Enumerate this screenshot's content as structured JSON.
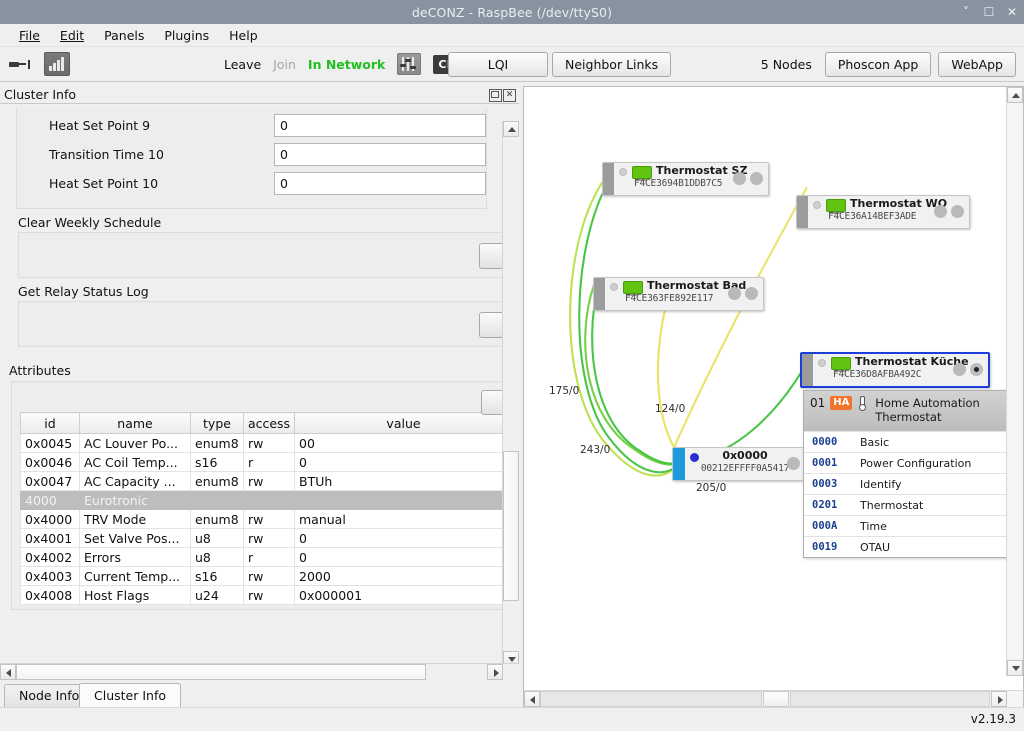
{
  "window": {
    "title": "deCONZ - RaspBee (/dev/ttyS0)",
    "minimize_icon": "chevron-down-icon",
    "maximize_icon": "square-icon",
    "close_icon": "close-icon"
  },
  "menubar": [
    {
      "label": "File"
    },
    {
      "label": "Edit"
    },
    {
      "label": "Panels"
    },
    {
      "label": "Plugins"
    },
    {
      "label": "Help"
    }
  ],
  "toolbar": {
    "connect_icon": "plug-icon",
    "stats_icon": "bar-chart-icon",
    "leave_label": "Leave",
    "join_label": "Join",
    "network_status": "In Network",
    "settings_icon": "sliders-icon",
    "cre_badge": "CRE",
    "lqi_label": "LQI",
    "neighbor_links_label": "Neighbor Links",
    "nodes_label": "5 Nodes",
    "phoscon_label": "Phoscon App",
    "webapp_label": "WebApp"
  },
  "dock": {
    "title": "Cluster Info",
    "float_icon": "undock-icon",
    "close_icon": "close-icon",
    "fields": [
      {
        "label": "Heat Set Point 9",
        "value": "0"
      },
      {
        "label": "Transition Time 10",
        "value": "0"
      },
      {
        "label": "Heat Set Point 10",
        "value": "0"
      }
    ],
    "commands": [
      {
        "label": "Clear Weekly Schedule"
      },
      {
        "label": "Get Relay Status Log"
      }
    ],
    "attributes_label": "Attributes",
    "table": {
      "headers": [
        "id",
        "name",
        "type",
        "access",
        "value"
      ],
      "rows": [
        {
          "group": false,
          "id": "0x0045",
          "name": "AC Louver Po...",
          "type": "enum8",
          "access": "rw",
          "value": "00"
        },
        {
          "group": false,
          "id": "0x0046",
          "name": "AC Coil Temp...",
          "type": "s16",
          "access": "r",
          "value": "0"
        },
        {
          "group": false,
          "id": "0x0047",
          "name": "AC Capacity ...",
          "type": "enum8",
          "access": "rw",
          "value": "BTUh"
        },
        {
          "group": true,
          "id": "4000",
          "name": "Eurotronic",
          "type": "",
          "access": "",
          "value": ""
        },
        {
          "group": false,
          "id": "0x4000",
          "name": "TRV Mode",
          "type": "enum8",
          "access": "rw",
          "value": "manual"
        },
        {
          "group": false,
          "id": "0x4001",
          "name": "Set Valve Pos...",
          "type": "u8",
          "access": "rw",
          "value": "0"
        },
        {
          "group": false,
          "id": "0x4002",
          "name": "Errors",
          "type": "u8",
          "access": "r",
          "value": "0"
        },
        {
          "group": false,
          "id": "0x4003",
          "name": "Current Temp...",
          "type": "s16",
          "access": "rw",
          "value": "2000"
        },
        {
          "group": false,
          "id": "0x4008",
          "name": "Host Flags",
          "type": "u24",
          "access": "rw",
          "value": "0x000001"
        }
      ]
    }
  },
  "tabs": [
    {
      "label": "Node Info",
      "active": false
    },
    {
      "label": "Cluster Info",
      "active": true
    }
  ],
  "graph": {
    "nodes": [
      {
        "name": "Thermostat SZ",
        "mac": "F4CE3694B1DDB7C5",
        "selected": false,
        "coordinator": false
      },
      {
        "name": "Thermostat WO",
        "mac": "F4CE36A14BEF3ADE",
        "selected": false,
        "coordinator": false
      },
      {
        "name": "Thermostat Bad",
        "mac": "F4CE363FE892E117",
        "selected": false,
        "coordinator": false
      },
      {
        "name": "Thermostat Küche",
        "mac": "F4CE36D8AFBA492C",
        "selected": true,
        "coordinator": false
      },
      {
        "name": "0x0000",
        "mac": "00212EFFFF0A5417",
        "selected": false,
        "coordinator": true
      }
    ],
    "link_labels": [
      "175/0",
      "243/0",
      "124/0",
      "205/0"
    ]
  },
  "cluster_panel": {
    "endpoint": "01",
    "profile_badge": "HA",
    "device_icon": "thermometer-icon",
    "title": "Home Automation Thermostat",
    "clusters": [
      {
        "id": "0000",
        "name": "Basic"
      },
      {
        "id": "0001",
        "name": "Power Configuration"
      },
      {
        "id": "0003",
        "name": "Identify"
      },
      {
        "id": "0201",
        "name": "Thermostat"
      },
      {
        "id": "000A",
        "name": "Time"
      },
      {
        "id": "0019",
        "name": "OTAU"
      }
    ]
  },
  "statusbar": {
    "version": "v2.19.3"
  },
  "colors": {
    "titlebar": "#8794a0",
    "network_green": "#22c021",
    "selection_blue": "#1b3fd8",
    "coordinator_blue": "#1c9ada",
    "ha_badge": "#f0742b",
    "cluster_id": "#1b3f8f"
  }
}
